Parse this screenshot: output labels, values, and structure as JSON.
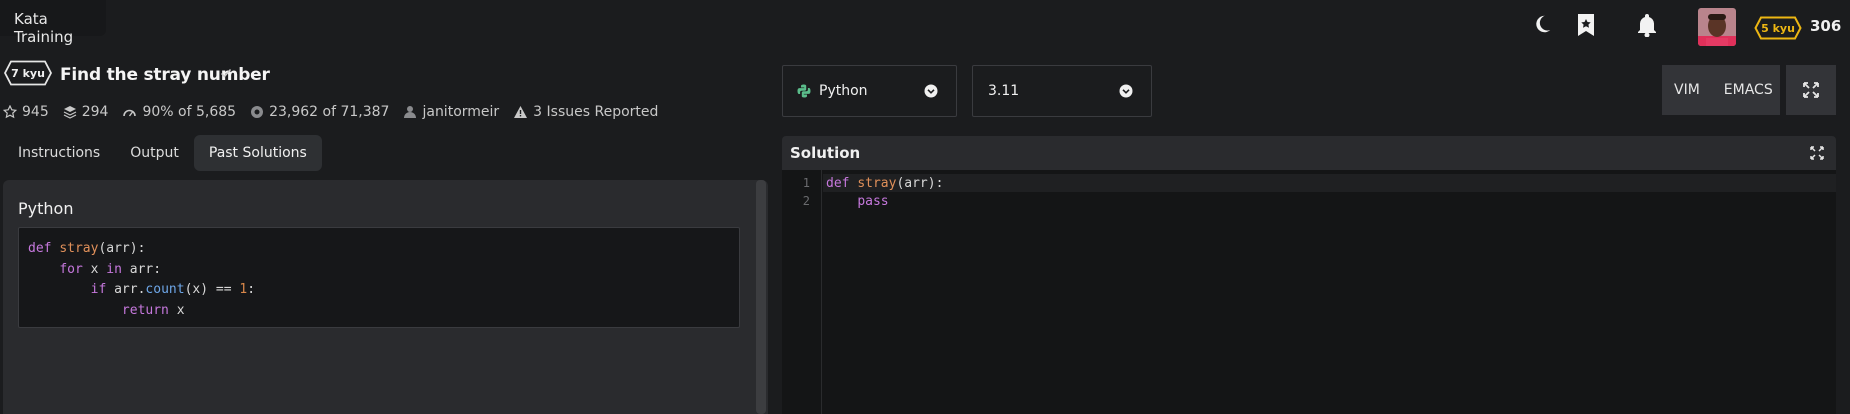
{
  "header": {
    "page_title": "Kata Training",
    "rank_badge": "5 kyu",
    "honor": "306",
    "icons": [
      "moon-icon",
      "bookmark-icon",
      "bell-icon"
    ]
  },
  "kata": {
    "kyu": "7 kyu",
    "title": "Find the stray number",
    "stats": {
      "stars": "945",
      "collections": "294",
      "satisfaction": "90%",
      "satisfaction_of": "of 5,685",
      "completed": "23,962",
      "completed_of": "of 71,387",
      "author": "janitormeir",
      "issues": "3 Issues Reported"
    }
  },
  "tabs": [
    {
      "label": "Instructions",
      "active": false
    },
    {
      "label": "Output",
      "active": false
    },
    {
      "label": "Past Solutions",
      "active": true
    }
  ],
  "past_solution": {
    "language": "Python",
    "code_lines": [
      "def stray(arr):",
      "    for x in arr:",
      "        if arr.count(x) == 1:",
      "            return x"
    ]
  },
  "editor": {
    "language": "Python",
    "version": "3.11",
    "modes": [
      "VIM",
      "EMACS"
    ],
    "panel_title": "Solution",
    "line_numbers": [
      "1",
      "2"
    ],
    "code_lines": [
      "def stray(arr):",
      "    pass"
    ]
  },
  "colors": {
    "background": "#1b1c1e",
    "panel": "#2a2b2e",
    "keyword": "#c678dd",
    "function": "#e0905a",
    "rank_yellow": "#ecb613",
    "python_green": "#5bbd8b"
  }
}
